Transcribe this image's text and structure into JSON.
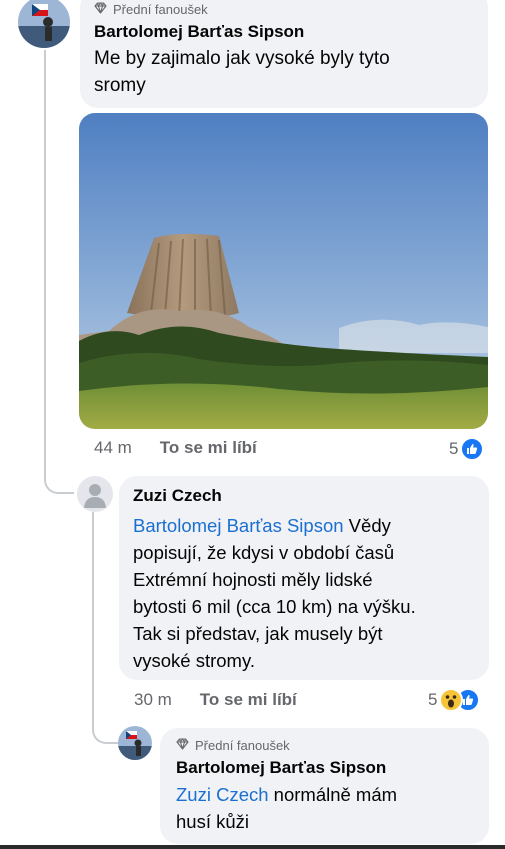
{
  "comments": [
    {
      "badge": "Přední fanoušek",
      "author": "Bartolomej Barťas Sipson",
      "text_lines": [
        "Me by zajimalo jak vysoké byly tyto",
        "sromy"
      ],
      "time": "44 m",
      "like_label": "To se mi líbí",
      "reaction_count": "5"
    },
    {
      "author": "Zuzi Czech",
      "mention": "Bartolomej Barťas Sipson",
      "text_lines": [
        " Vědy",
        "popisují, že kdysi v období časů",
        "Extrémní hojnosti měly lidské",
        "bytosti 6 mil (cca 10 km) na výšku.",
        "Tak si představ, jak musely být",
        "vysoké stromy."
      ],
      "time": "30 m",
      "like_label": "To se mi líbí",
      "reaction_count": "5"
    },
    {
      "badge": "Přední fanoušek",
      "author": "Bartolomej Barťas Sipson",
      "mention": "Zuzi Czech",
      "text_lines": [
        " normálně mám",
        "husí kůži"
      ]
    }
  ],
  "icons": [
    "diamond-icon",
    "like-icon",
    "wow-icon",
    "user-icon"
  ],
  "colors": {
    "bubble": "#f0f2f5",
    "mention": "#1b6fd0",
    "like_blue": "#1877f2",
    "muted": "#65676b"
  }
}
